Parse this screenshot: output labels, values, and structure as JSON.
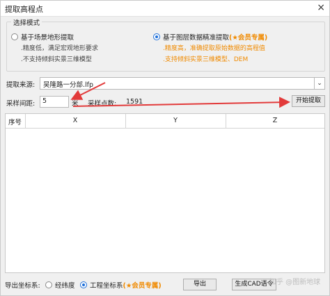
{
  "window": {
    "title": "提取高程点",
    "close_glyph": "×"
  },
  "mode": {
    "group_title": "选择模式",
    "option1": {
      "label": "基于场景地形提取",
      "lines": [
        ".精度低，满足宏观地形要求",
        ".不支持倾斜实景三维模型"
      ]
    },
    "option2": {
      "label": "基于图层数据精准提取",
      "vip": "(★会员专属)",
      "lines": [
        ".精度高，准确提取原始数据的高程值",
        ".支持倾斜实景三维模型、DEM"
      ]
    }
  },
  "source": {
    "label": "提取来源:",
    "value": "吴隆路一分部.lfp"
  },
  "interval": {
    "label": "采样间距:",
    "value": "5",
    "unit": "米",
    "count_label": "采样点数:",
    "count": "1591"
  },
  "start_button": "开始提取",
  "table": {
    "columns": [
      "序号",
      "X",
      "Y",
      "Z"
    ]
  },
  "footer": {
    "coord_label": "导出坐标系:",
    "opt_latlon": "经纬度",
    "opt_project": "工程坐标系",
    "vip": "(★会员专属)",
    "export_button": "导出",
    "cad_button": "生成CAD语令"
  },
  "watermark": "知乎 @图新地球"
}
